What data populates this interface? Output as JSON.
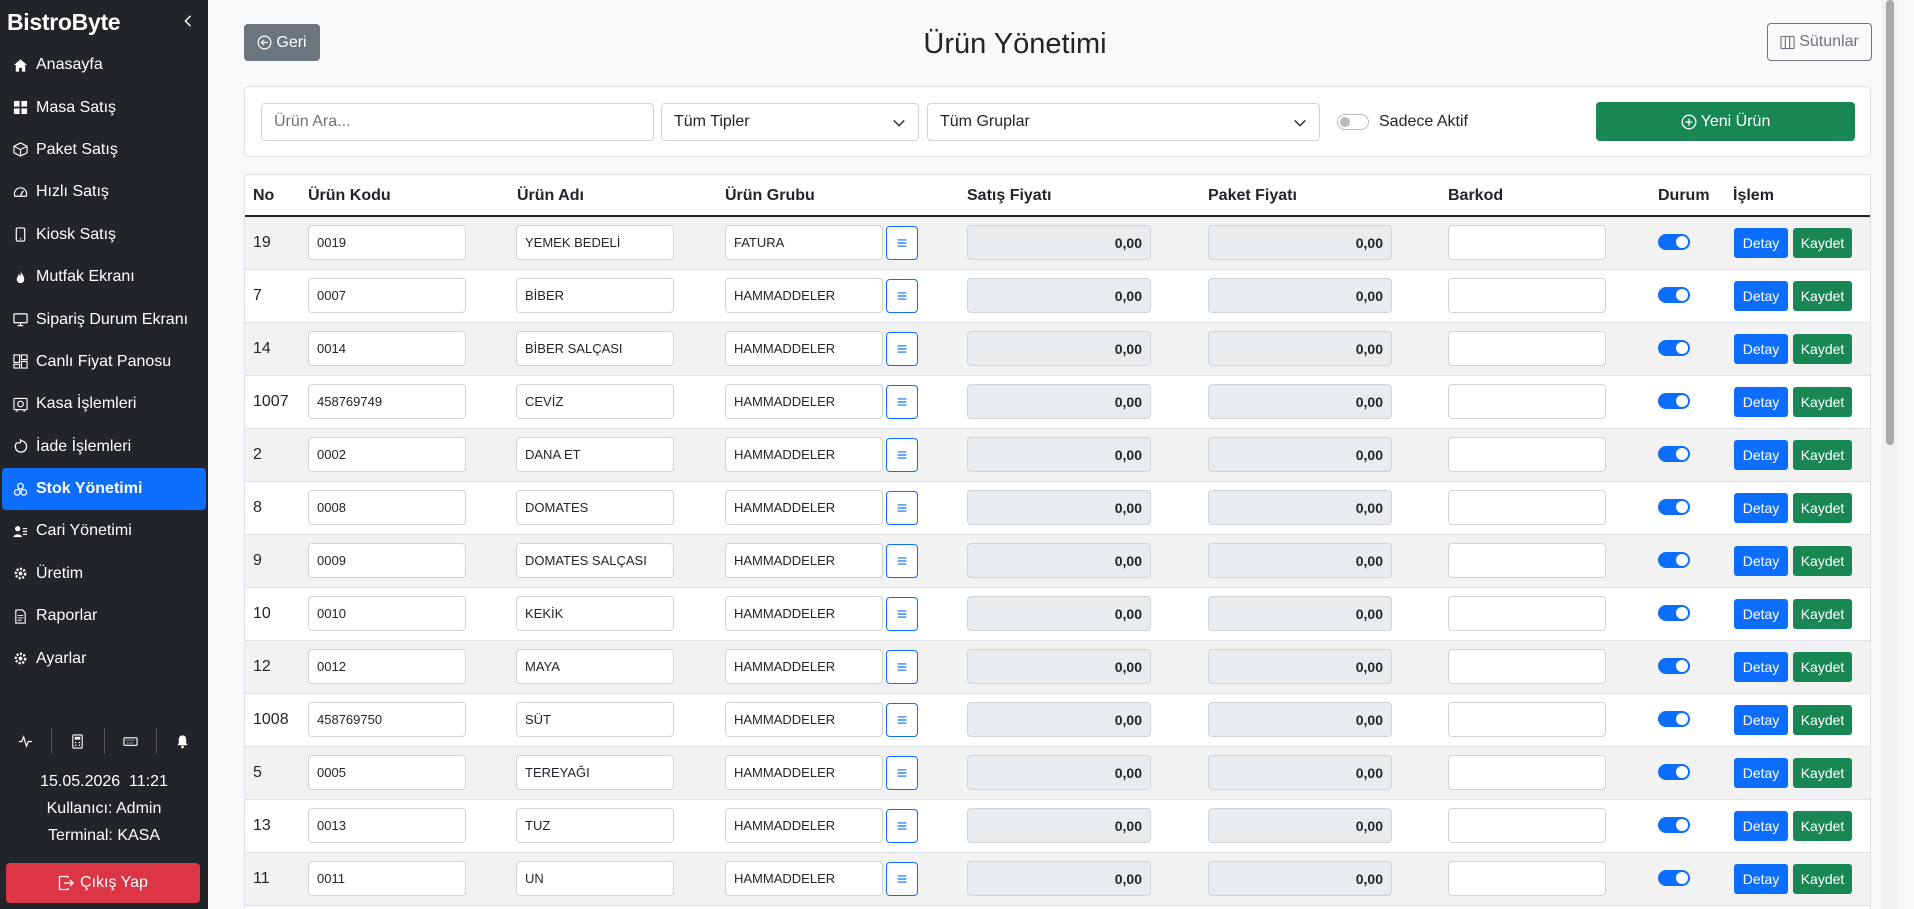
{
  "sidebar": {
    "brand": "BistroByte",
    "items": [
      {
        "label": "Anasayfa",
        "icon": "home-icon"
      },
      {
        "label": "Masa Satış",
        "icon": "grid-icon"
      },
      {
        "label": "Paket Satış",
        "icon": "box-icon"
      },
      {
        "label": "Hızlı Satış",
        "icon": "speedometer-icon"
      },
      {
        "label": "Kiosk Satış",
        "icon": "tablet-icon"
      },
      {
        "label": "Mutfak Ekranı",
        "icon": "fire-icon"
      },
      {
        "label": "Sipariş Durum Ekranı",
        "icon": "monitor-icon"
      },
      {
        "label": "Canlı Fiyat Panosu",
        "icon": "dashboard-icon"
      },
      {
        "label": "Kasa İşlemleri",
        "icon": "safe-icon"
      },
      {
        "label": "İade İşlemleri",
        "icon": "undo-icon"
      },
      {
        "label": "Stok Yönetimi",
        "icon": "boxes-icon",
        "active": true
      },
      {
        "label": "Cari Yönetimi",
        "icon": "people-icon"
      },
      {
        "label": "Üretim",
        "icon": "gear-icon"
      },
      {
        "label": "Raporlar",
        "icon": "file-icon"
      },
      {
        "label": "Ayarlar",
        "icon": "gear-icon"
      }
    ],
    "date": "15.05.2026",
    "time": "11:21",
    "user": "Kullanıcı: Admin",
    "terminal": "Terminal: KASA",
    "logout": "Çıkış Yap"
  },
  "header": {
    "back": "Geri",
    "title": "Ürün Yönetimi",
    "columns": "Sütunlar"
  },
  "filters": {
    "search_placeholder": "Ürün Ara...",
    "type": "Tüm Tipler",
    "group": "Tüm Gruplar",
    "active_only": "Sadece Aktif",
    "new_product": "Yeni Ürün"
  },
  "table": {
    "headers": [
      "No",
      "Ürün Kodu",
      "Ürün Adı",
      "Ürün Grubu",
      "Satış Fiyatı",
      "Paket Fiyatı",
      "Barkod",
      "Durum",
      "İşlem"
    ],
    "detail_label": "Detay",
    "save_label": "Kaydet",
    "rows": [
      {
        "no": "19",
        "code": "0019",
        "name": "YEMEK BEDELİ",
        "group": "FATURA",
        "price": "0,00",
        "package_price": "0,00",
        "barcode": ""
      },
      {
        "no": "7",
        "code": "0007",
        "name": "BİBER",
        "group": "HAMMADDELER",
        "price": "0,00",
        "package_price": "0,00",
        "barcode": ""
      },
      {
        "no": "14",
        "code": "0014",
        "name": "BİBER SALÇASI",
        "group": "HAMMADDELER",
        "price": "0,00",
        "package_price": "0,00",
        "barcode": ""
      },
      {
        "no": "1007",
        "code": "458769749",
        "name": "CEVİZ",
        "group": "HAMMADDELER",
        "price": "0,00",
        "package_price": "0,00",
        "barcode": ""
      },
      {
        "no": "2",
        "code": "0002",
        "name": "DANA ET",
        "group": "HAMMADDELER",
        "price": "0,00",
        "package_price": "0,00",
        "barcode": ""
      },
      {
        "no": "8",
        "code": "0008",
        "name": "DOMATES",
        "group": "HAMMADDELER",
        "price": "0,00",
        "package_price": "0,00",
        "barcode": ""
      },
      {
        "no": "9",
        "code": "0009",
        "name": "DOMATES SALÇASI",
        "group": "HAMMADDELER",
        "price": "0,00",
        "package_price": "0,00",
        "barcode": ""
      },
      {
        "no": "10",
        "code": "0010",
        "name": "KEKİK",
        "group": "HAMMADDELER",
        "price": "0,00",
        "package_price": "0,00",
        "barcode": ""
      },
      {
        "no": "12",
        "code": "0012",
        "name": "MAYA",
        "group": "HAMMADDELER",
        "price": "0,00",
        "package_price": "0,00",
        "barcode": ""
      },
      {
        "no": "1008",
        "code": "458769750",
        "name": "SÜT",
        "group": "HAMMADDELER",
        "price": "0,00",
        "package_price": "0,00",
        "barcode": ""
      },
      {
        "no": "5",
        "code": "0005",
        "name": "TEREYAĞI",
        "group": "HAMMADDELER",
        "price": "0,00",
        "package_price": "0,00",
        "barcode": ""
      },
      {
        "no": "13",
        "code": "0013",
        "name": "TUZ",
        "group": "HAMMADDELER",
        "price": "0,00",
        "package_price": "0,00",
        "barcode": ""
      },
      {
        "no": "11",
        "code": "0011",
        "name": "UN",
        "group": "HAMMADDELER",
        "price": "0,00",
        "package_price": "0,00",
        "barcode": ""
      }
    ]
  },
  "colors": {
    "sidebar_bg": "#212529",
    "primary": "#0d6efd",
    "success": "#198754",
    "danger": "#dc3545",
    "secondary": "#6c757d"
  }
}
